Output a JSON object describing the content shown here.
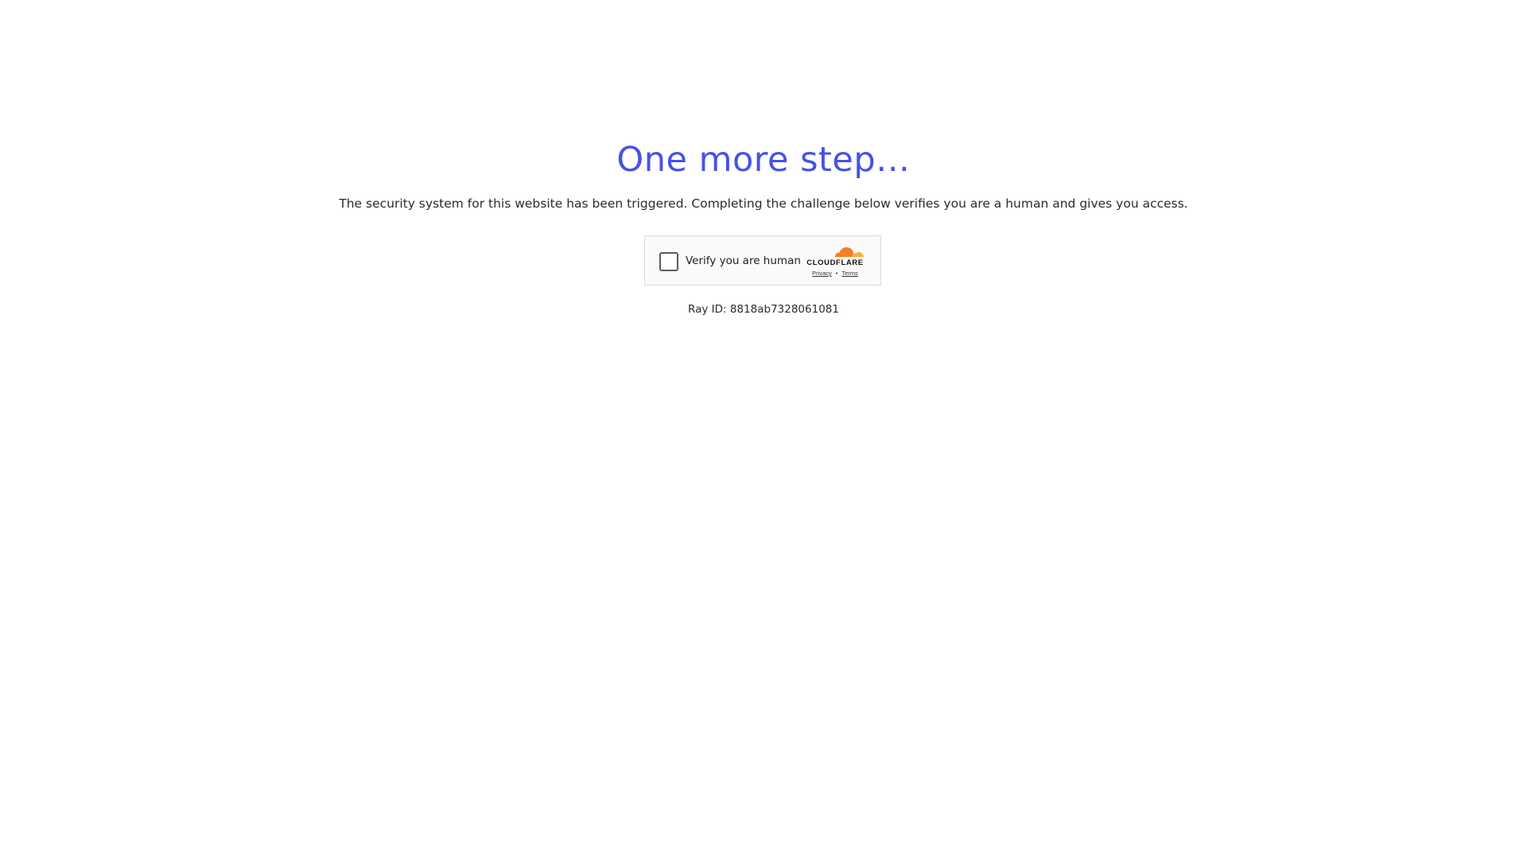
{
  "heading": "One more step…",
  "description": "The security system for this website has been triggered. Completing the challenge below verifies you are a human and gives you access.",
  "challenge_widget": {
    "checkbox_label": "Verify you are human",
    "brand_name": "CLOUDFLARE",
    "privacy_link": "Privacy",
    "separator": "•",
    "terms_link": "Terms",
    "brand_colors": {
      "orange_dark": "#f38020",
      "orange_light": "#faae40"
    }
  },
  "ray_id": "Ray ID: 8818ab7328061081",
  "colors": {
    "heading": "#4652e6",
    "text": "#2b2b2b"
  }
}
